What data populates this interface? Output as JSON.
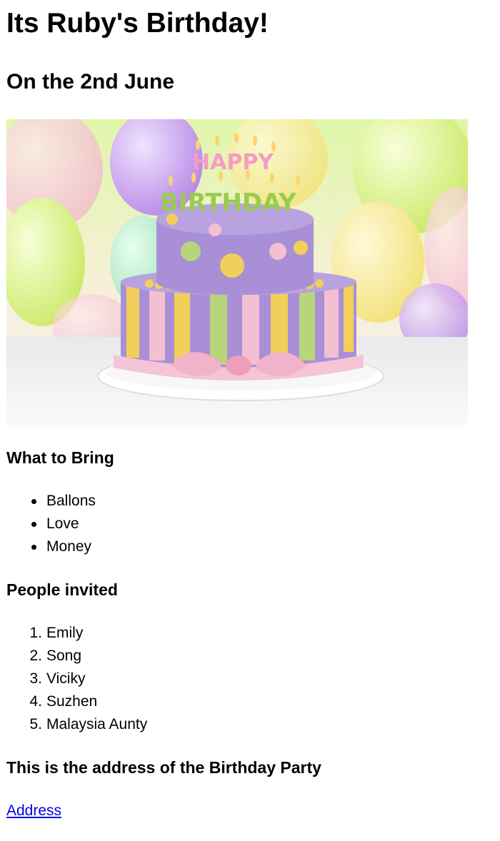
{
  "header": {
    "title": "Its Ruby's Birthday!",
    "subtitle": "On the 2nd June"
  },
  "image": {
    "subject": "birthday-cake",
    "candle_text_top": "HAPPY",
    "candle_text_bottom": "BIRTHDAY"
  },
  "bring": {
    "heading": "What to Bring",
    "items": [
      "Ballons",
      "Love",
      "Money"
    ]
  },
  "people": {
    "heading": "People invited",
    "items": [
      {
        "num": "1.",
        "name": "Emily"
      },
      {
        "num": "2.",
        "name": "Song"
      },
      {
        "num": "3.",
        "name": "Viciky"
      },
      {
        "num": "4.",
        "name": "Suzhen"
      },
      {
        "num": "5.",
        "name": "Malaysia Aunty"
      }
    ]
  },
  "address": {
    "heading": "This is the address of the Birthday Party",
    "link_text": "Address"
  },
  "colors": {
    "link": "#0000ee",
    "cake_purple": "#a98fd6",
    "cake_yellow": "#f2cf5a",
    "cake_green": "#b7d57a",
    "cake_pink": "#f3bfd3"
  }
}
